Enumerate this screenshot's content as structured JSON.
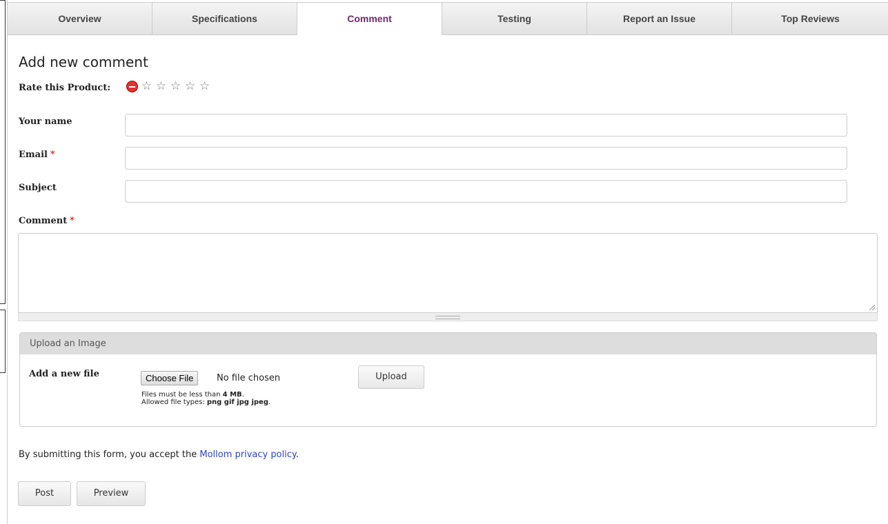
{
  "tabs": [
    {
      "label": "Overview"
    },
    {
      "label": "Specifications"
    },
    {
      "label": "Comment"
    },
    {
      "label": "Testing"
    },
    {
      "label": "Report an Issue"
    },
    {
      "label": "Top Reviews"
    }
  ],
  "active_tab": "Comment",
  "form": {
    "title": "Add new comment",
    "rating_label": "Rate this Product:",
    "rating_value": 0,
    "rating_max": 5,
    "star_glyph": "☆",
    "name_label": "Your name",
    "name_value": "",
    "email_label": "Email",
    "email_value": "",
    "subject_label": "Subject",
    "subject_value": "",
    "comment_label": "Comment",
    "comment_value": "",
    "required_marker": "*"
  },
  "upload": {
    "legend": "Upload an Image",
    "add_label": "Add a new file",
    "choose_button": "Choose File",
    "file_status": "No file chosen",
    "upload_button": "Upload",
    "size_text": "Files must be less than ",
    "size_value": "4 MB",
    "size_suffix": ".",
    "types_text": "Allowed file types: ",
    "types_value": "png gif jpg jpeg",
    "types_suffix": "."
  },
  "privacy": {
    "prefix": "By submitting this form, you accept the ",
    "link": "Mollom privacy policy",
    "suffix": "."
  },
  "actions": {
    "post": "Post",
    "preview": "Preview"
  },
  "colors": {
    "active_tab_text": "#6a2a6a",
    "link": "#2a44c8",
    "required": "#cc0000",
    "cancel_icon": "#dd3333"
  }
}
